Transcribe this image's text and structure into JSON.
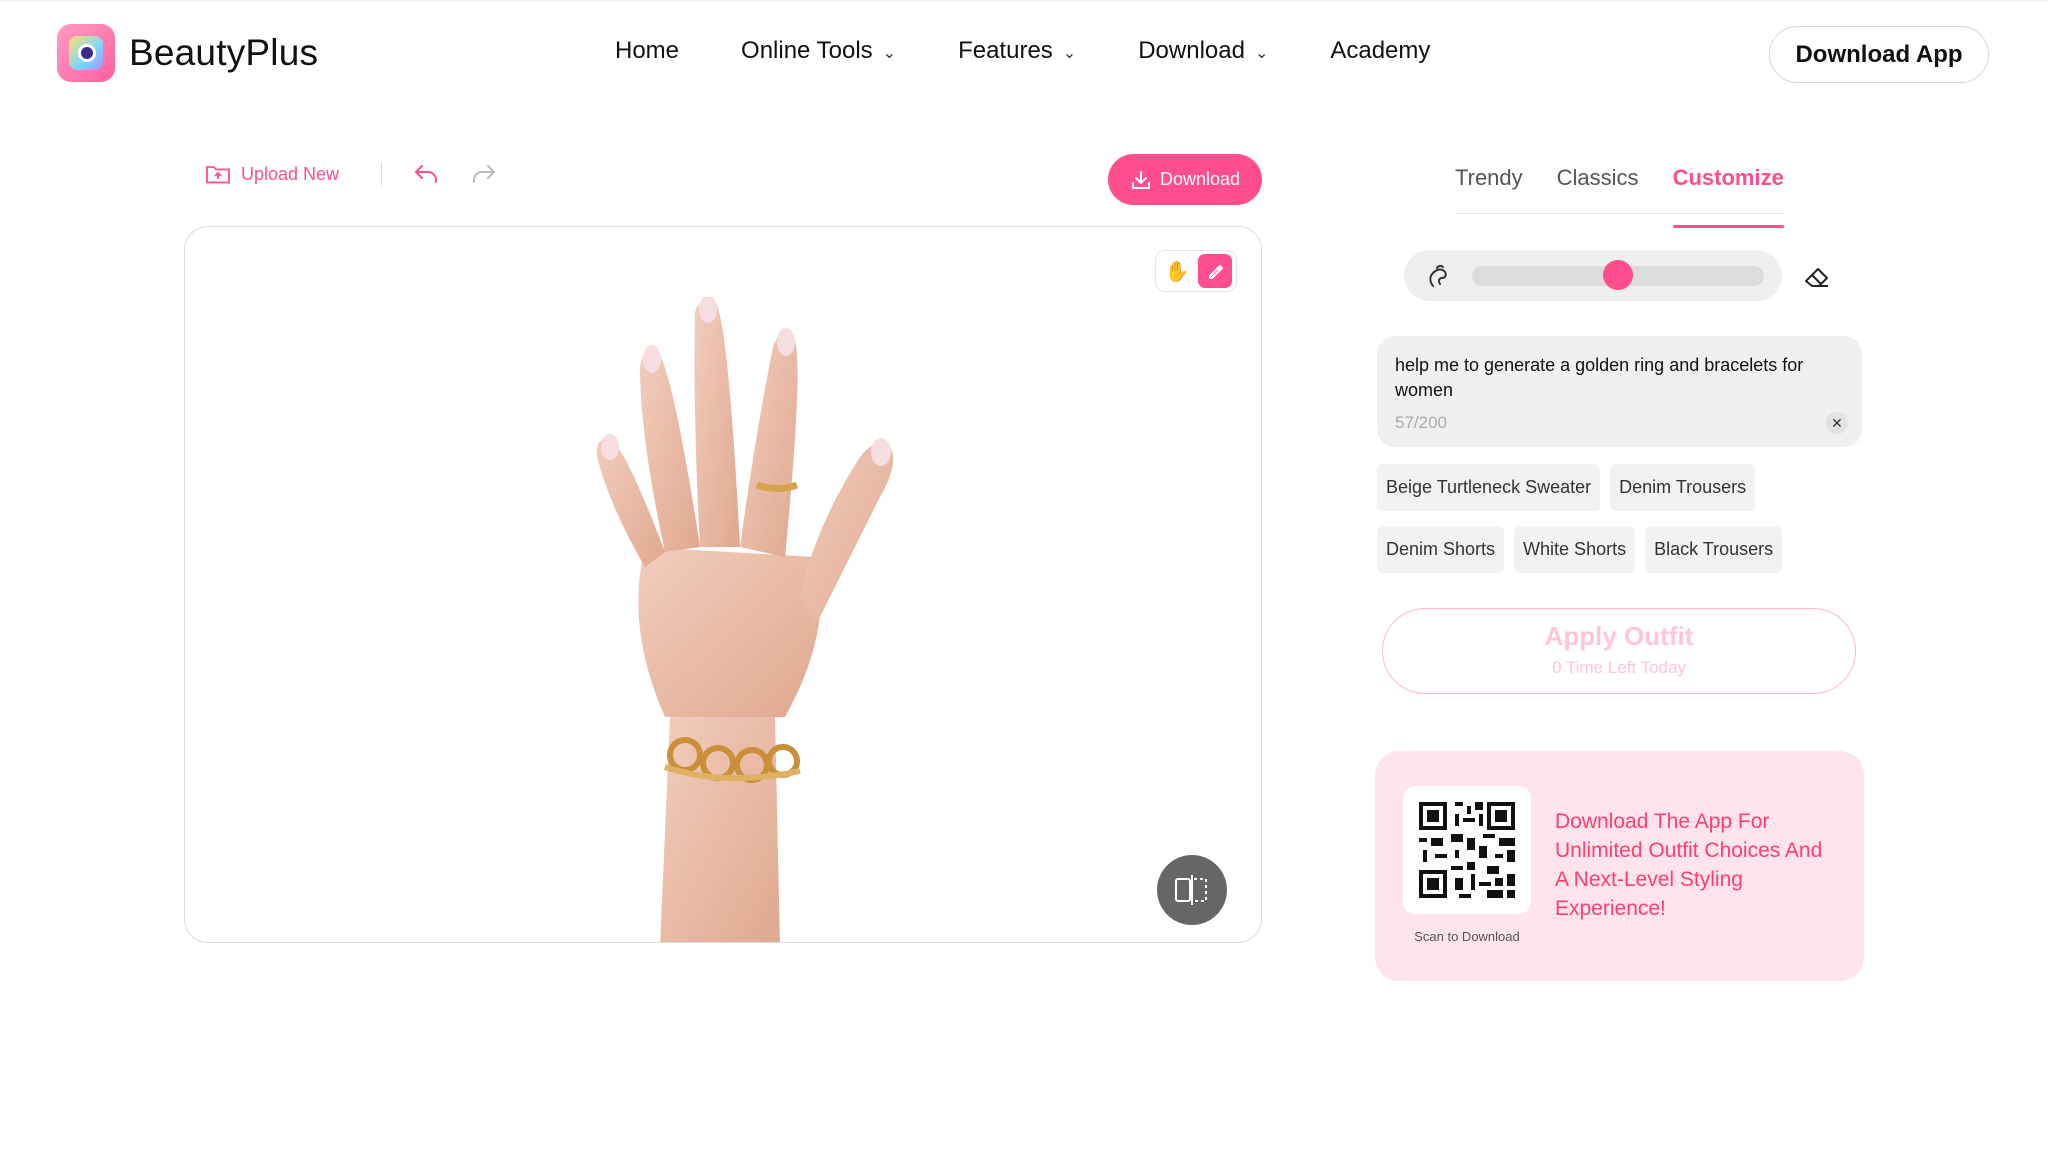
{
  "header": {
    "brand": "BeautyPlus",
    "nav": [
      {
        "label": "Home",
        "dropdown": false
      },
      {
        "label": "Online Tools",
        "dropdown": true
      },
      {
        "label": "Features",
        "dropdown": true
      },
      {
        "label": "Download",
        "dropdown": true
      },
      {
        "label": "Academy",
        "dropdown": false
      }
    ],
    "cta": "Download App"
  },
  "editor": {
    "upload_new": "Upload New",
    "download": "Download"
  },
  "panel": {
    "tabs": [
      {
        "label": "Trendy",
        "active": false
      },
      {
        "label": "Classics",
        "active": false
      },
      {
        "label": "Customize",
        "active": true
      }
    ],
    "brush_size": 0.5,
    "prompt": {
      "text": "help me to generate a golden ring and bracelets for women",
      "count": "57/200"
    },
    "suggestions": [
      "Beige Turtleneck Sweater",
      "Denim Trousers",
      "Denim Shorts",
      "White Shorts",
      "Black Trousers"
    ],
    "apply": {
      "label": "Apply Outfit",
      "sub": "0 Time Left Today"
    }
  },
  "promo": {
    "caption": "Scan to Download",
    "text": "Download The App For Unlimited Outfit Choices And A Next-Level Styling Experience!"
  },
  "colors": {
    "accent": "#ff4d8d",
    "promo_bg": "#ffe4ee",
    "promo_text": "#ff3e6e"
  }
}
